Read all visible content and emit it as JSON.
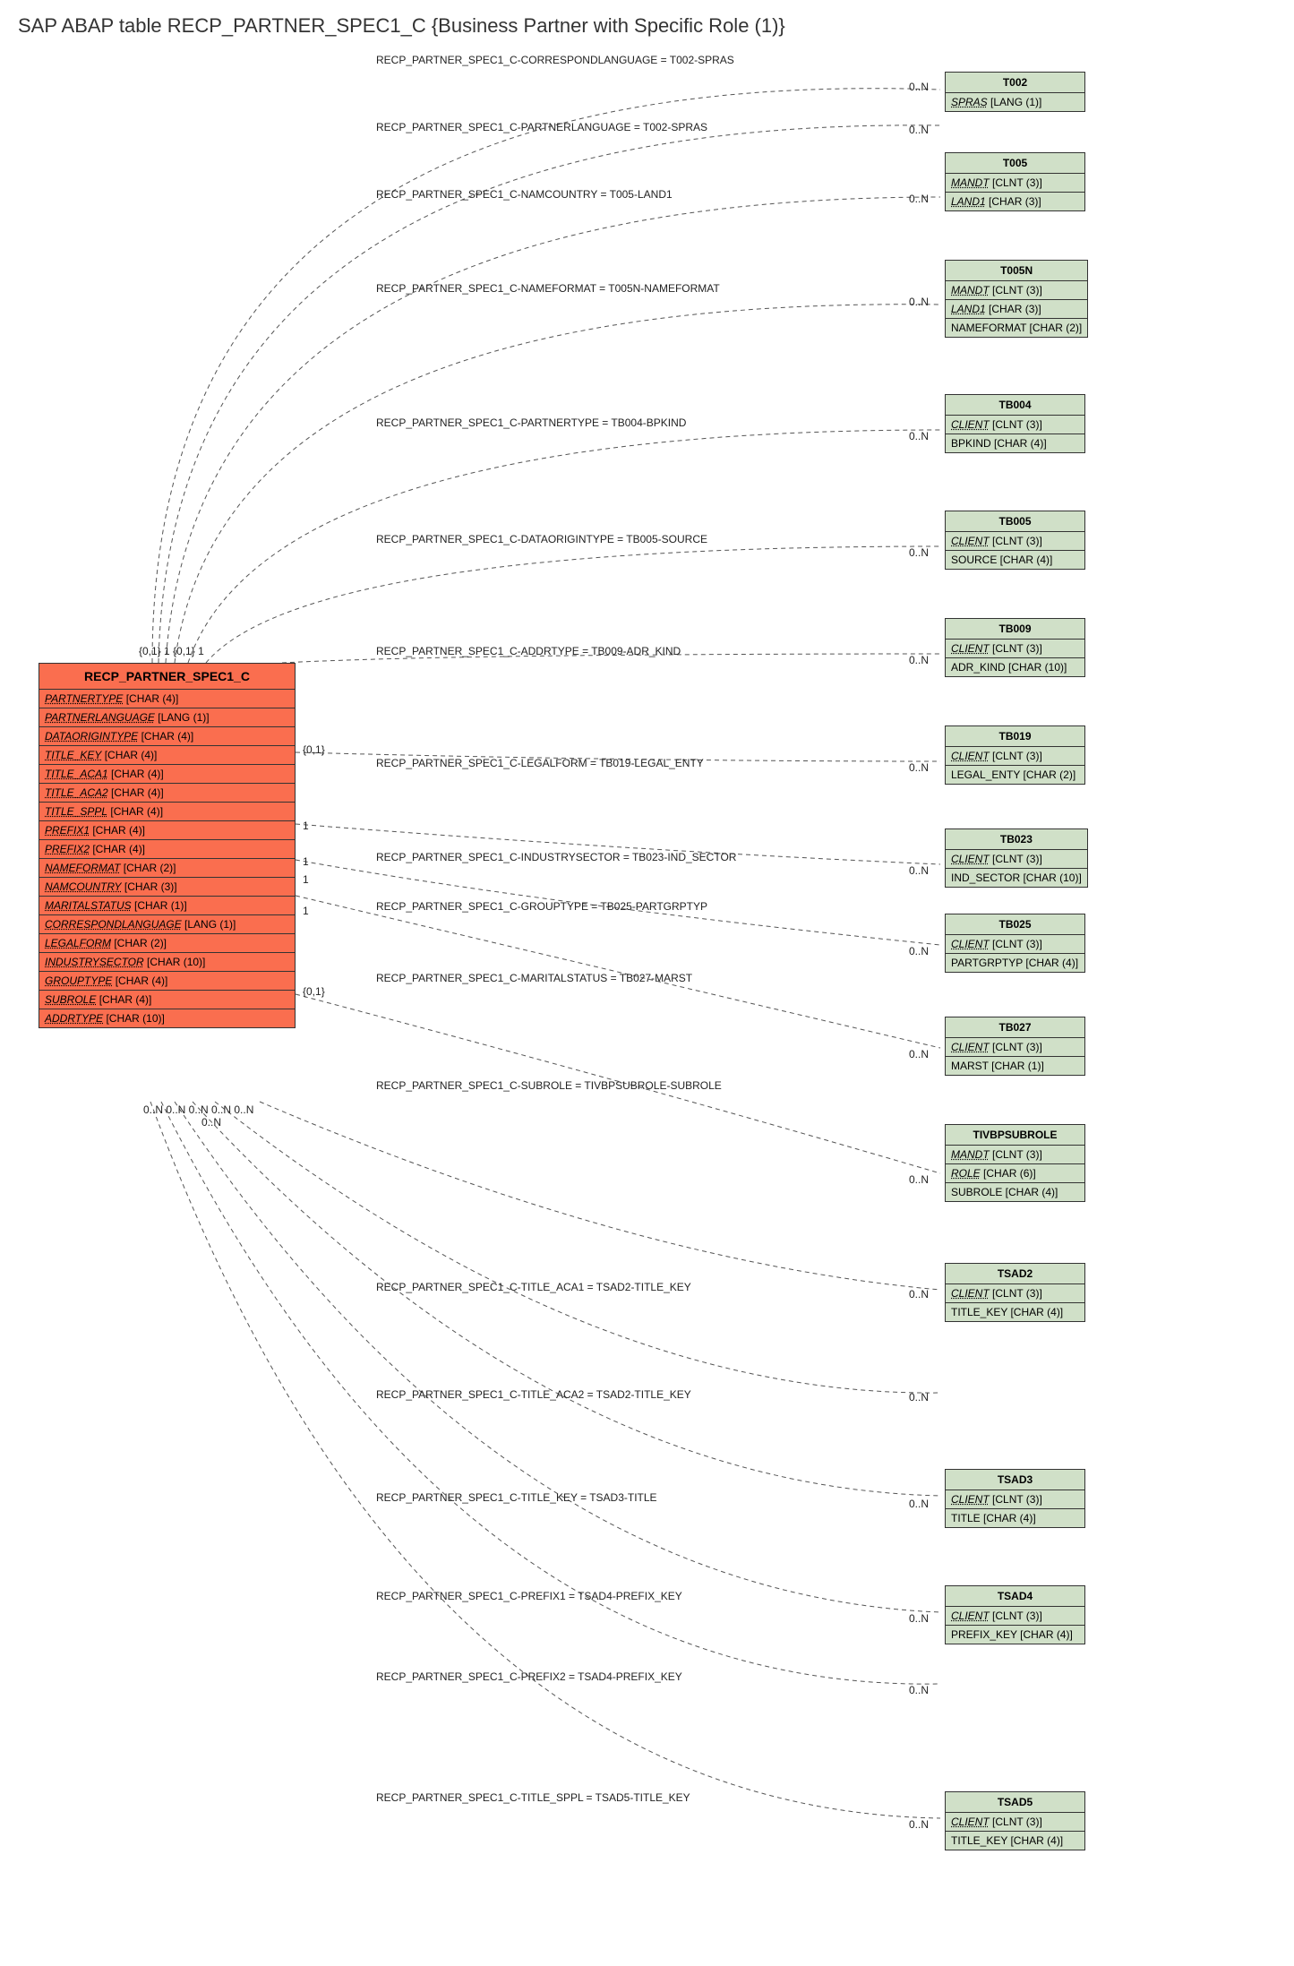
{
  "title": "SAP ABAP table RECP_PARTNER_SPEC1_C {Business Partner with Specific Role (1)}",
  "main": {
    "name": "RECP_PARTNER_SPEC1_C",
    "fields": [
      {
        "name": "PARTNERTYPE",
        "type": "[CHAR (4)]"
      },
      {
        "name": "PARTNERLANGUAGE",
        "type": "[LANG (1)]"
      },
      {
        "name": "DATAORIGINTYPE",
        "type": "[CHAR (4)]"
      },
      {
        "name": "TITLE_KEY",
        "type": "[CHAR (4)]"
      },
      {
        "name": "TITLE_ACA1",
        "type": "[CHAR (4)]"
      },
      {
        "name": "TITLE_ACA2",
        "type": "[CHAR (4)]"
      },
      {
        "name": "TITLE_SPPL",
        "type": "[CHAR (4)]"
      },
      {
        "name": "PREFIX1",
        "type": "[CHAR (4)]"
      },
      {
        "name": "PREFIX2",
        "type": "[CHAR (4)]"
      },
      {
        "name": "NAMEFORMAT",
        "type": "[CHAR (2)]"
      },
      {
        "name": "NAMCOUNTRY",
        "type": "[CHAR (3)]"
      },
      {
        "name": "MARITALSTATUS",
        "type": "[CHAR (1)]"
      },
      {
        "name": "CORRESPONDLANGUAGE",
        "type": "[LANG (1)]"
      },
      {
        "name": "LEGALFORM",
        "type": "[CHAR (2)]"
      },
      {
        "name": "INDUSTRYSECTOR",
        "type": "[CHAR (10)]"
      },
      {
        "name": "GROUPTYPE",
        "type": "[CHAR (4)]"
      },
      {
        "name": "SUBROLE",
        "type": "[CHAR (4)]"
      },
      {
        "name": "ADDRTYPE",
        "type": "[CHAR (10)]"
      }
    ]
  },
  "refs": [
    {
      "name": "T002",
      "fields": [
        {
          "n": "SPRAS",
          "t": "[LANG (1)]",
          "fk": true
        }
      ]
    },
    {
      "name": "T005",
      "fields": [
        {
          "n": "MANDT",
          "t": "[CLNT (3)]",
          "fk": true
        },
        {
          "n": "LAND1",
          "t": "[CHAR (3)]",
          "fk": true
        }
      ]
    },
    {
      "name": "T005N",
      "fields": [
        {
          "n": "MANDT",
          "t": "[CLNT (3)]",
          "fk": true
        },
        {
          "n": "LAND1",
          "t": "[CHAR (3)]",
          "fk": true
        },
        {
          "n": "NAMEFORMAT",
          "t": "[CHAR (2)]",
          "fk": false
        }
      ]
    },
    {
      "name": "TB004",
      "fields": [
        {
          "n": "CLIENT",
          "t": "[CLNT (3)]",
          "fk": true
        },
        {
          "n": "BPKIND",
          "t": "[CHAR (4)]",
          "fk": false
        }
      ]
    },
    {
      "name": "TB005",
      "fields": [
        {
          "n": "CLIENT",
          "t": "[CLNT (3)]",
          "fk": true
        },
        {
          "n": "SOURCE",
          "t": "[CHAR (4)]",
          "fk": false
        }
      ]
    },
    {
      "name": "TB009",
      "fields": [
        {
          "n": "CLIENT",
          "t": "[CLNT (3)]",
          "fk": true
        },
        {
          "n": "ADR_KIND",
          "t": "[CHAR (10)]",
          "fk": false
        }
      ]
    },
    {
      "name": "TB019",
      "fields": [
        {
          "n": "CLIENT",
          "t": "[CLNT (3)]",
          "fk": true
        },
        {
          "n": "LEGAL_ENTY",
          "t": "[CHAR (2)]",
          "fk": false
        }
      ]
    },
    {
      "name": "TB023",
      "fields": [
        {
          "n": "CLIENT",
          "t": "[CLNT (3)]",
          "fk": true
        },
        {
          "n": "IND_SECTOR",
          "t": "[CHAR (10)]",
          "fk": false
        }
      ]
    },
    {
      "name": "TB025",
      "fields": [
        {
          "n": "CLIENT",
          "t": "[CLNT (3)]",
          "fk": true
        },
        {
          "n": "PARTGRPTYP",
          "t": "[CHAR (4)]",
          "fk": false
        }
      ]
    },
    {
      "name": "TB027",
      "fields": [
        {
          "n": "CLIENT",
          "t": "[CLNT (3)]",
          "fk": true
        },
        {
          "n": "MARST",
          "t": "[CHAR (1)]",
          "fk": false
        }
      ]
    },
    {
      "name": "TIVBPSUBROLE",
      "fields": [
        {
          "n": "MANDT",
          "t": "[CLNT (3)]",
          "fk": true
        },
        {
          "n": "ROLE",
          "t": "[CHAR (6)]",
          "fk": true
        },
        {
          "n": "SUBROLE",
          "t": "[CHAR (4)]",
          "fk": false
        }
      ]
    },
    {
      "name": "TSAD2",
      "fields": [
        {
          "n": "CLIENT",
          "t": "[CLNT (3)]",
          "fk": true
        },
        {
          "n": "TITLE_KEY",
          "t": "[CHAR (4)]",
          "fk": false
        }
      ]
    },
    {
      "name": "TSAD3",
      "fields": [
        {
          "n": "CLIENT",
          "t": "[CLNT (3)]",
          "fk": true
        },
        {
          "n": "TITLE",
          "t": "[CHAR (4)]",
          "fk": false
        }
      ]
    },
    {
      "name": "TSAD4",
      "fields": [
        {
          "n": "CLIENT",
          "t": "[CLNT (3)]",
          "fk": true
        },
        {
          "n": "PREFIX_KEY",
          "t": "[CHAR (4)]",
          "fk": false
        }
      ]
    },
    {
      "name": "TSAD5",
      "fields": [
        {
          "n": "CLIENT",
          "t": "[CLNT (3)]",
          "fk": true
        },
        {
          "n": "TITLE_KEY",
          "t": "[CHAR (4)]",
          "fk": false
        }
      ]
    }
  ],
  "edges": [
    {
      "label": "RECP_PARTNER_SPEC1_C-CORRESPONDLANGUAGE = T002-SPRAS",
      "rc": "0..N"
    },
    {
      "label": "RECP_PARTNER_SPEC1_C-PARTNERLANGUAGE = T002-SPRAS",
      "rc": "0..N"
    },
    {
      "label": "RECP_PARTNER_SPEC1_C-NAMCOUNTRY = T005-LAND1",
      "rc": "0..N"
    },
    {
      "label": "RECP_PARTNER_SPEC1_C-NAMEFORMAT = T005N-NAMEFORMAT",
      "rc": "0..N"
    },
    {
      "label": "RECP_PARTNER_SPEC1_C-PARTNERTYPE = TB004-BPKIND",
      "rc": "0..N"
    },
    {
      "label": "RECP_PARTNER_SPEC1_C-DATAORIGINTYPE = TB005-SOURCE",
      "rc": "0..N"
    },
    {
      "label": "RECP_PARTNER_SPEC1_C-ADDRTYPE = TB009-ADR_KIND",
      "rc": "0..N"
    },
    {
      "label": "RECP_PARTNER_SPEC1_C-LEGALFORM = TB019-LEGAL_ENTY",
      "rc": "0..N"
    },
    {
      "label": "RECP_PARTNER_SPEC1_C-INDUSTRYSECTOR = TB023-IND_SECTOR",
      "rc": "0..N"
    },
    {
      "label": "RECP_PARTNER_SPEC1_C-GROUPTYPE = TB025-PARTGRPTYP",
      "rc": "0..N"
    },
    {
      "label": "RECP_PARTNER_SPEC1_C-MARITALSTATUS = TB027-MARST",
      "rc": "0..N"
    },
    {
      "label": "RECP_PARTNER_SPEC1_C-SUBROLE = TIVBPSUBROLE-SUBROLE",
      "rc": "0..N"
    },
    {
      "label": "RECP_PARTNER_SPEC1_C-TITLE_ACA1 = TSAD2-TITLE_KEY",
      "rc": "0..N"
    },
    {
      "label": "RECP_PARTNER_SPEC1_C-TITLE_ACA2 = TSAD2-TITLE_KEY",
      "rc": "0..N"
    },
    {
      "label": "RECP_PARTNER_SPEC1_C-TITLE_KEY = TSAD3-TITLE",
      "rc": "0..N"
    },
    {
      "label": "RECP_PARTNER_SPEC1_C-PREFIX1 = TSAD4-PREFIX_KEY",
      "rc": "0..N"
    },
    {
      "label": "RECP_PARTNER_SPEC1_C-PREFIX2 = TSAD4-PREFIX_KEY",
      "rc": "0..N"
    },
    {
      "label": "RECP_PARTNER_SPEC1_C-TITLE_SPPL = TSAD5-TITLE_KEY",
      "rc": "0..N"
    }
  ],
  "leftCardsTop": "{0,1} 1 {0,1}      1",
  "leftCardsMid": [
    "{0,1}",
    "1",
    "1",
    "1",
    "1",
    "{0,1}"
  ],
  "leftCardsBottom": "0..N 0..N 0..N 0..N    0..N",
  "leftCardsBottom2": "0..N"
}
